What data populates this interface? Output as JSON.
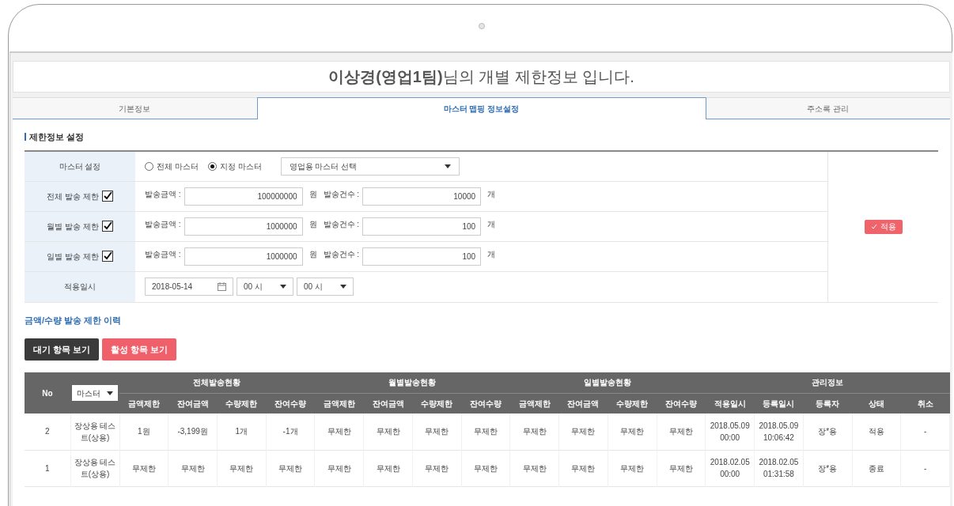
{
  "title": "**이상경(영업1팀)**님의 개별 제한정보 입니다.",
  "tabs": [
    {
      "label": "기본정보",
      "selected": false
    },
    {
      "label": "마스터 맵핑 정보설정",
      "selected": true
    },
    {
      "label": "주소록 관리",
      "selected": false
    }
  ],
  "section_title": "제한정보 설정",
  "form": {
    "master": {
      "label": "마스터 설정",
      "radios": [
        {
          "label": "전체 마스터",
          "selected": false
        },
        {
          "label": "지정 마스터",
          "selected": true
        }
      ],
      "select": "영업용 마스터 선택"
    },
    "limits": [
      {
        "label": "전체 발송 제한",
        "checked": true,
        "amount_label": "발송금액 :",
        "amount": "100000000",
        "amount_unit": "원",
        "count_label": "발송건수 :",
        "count": "10000",
        "count_unit": "개"
      },
      {
        "label": "월별 발송 제한",
        "checked": true,
        "amount_label": "발송금액 :",
        "amount": "1000000",
        "amount_unit": "원",
        "count_label": "발송건수 :",
        "count": "100",
        "count_unit": "개"
      },
      {
        "label": "일별 발송 제한",
        "checked": true,
        "amount_label": "발송금액 :",
        "amount": "1000000",
        "amount_unit": "원",
        "count_label": "발송건수 :",
        "count": "100",
        "count_unit": "개"
      }
    ],
    "apply_date": {
      "label": "적용일시",
      "date": "2018-05-14",
      "hour": "00 시",
      "minute": "00 시"
    },
    "apply_button": "적용"
  },
  "history_title": "금액/수량 발송 제한 이력",
  "view_buttons": [
    {
      "label": "대기 항목 보기",
      "kind": "dark"
    },
    {
      "label": "활성 항목 보기",
      "kind": "accent"
    }
  ],
  "table": {
    "header_rows": [
      [
        {
          "text": "No",
          "kind": "label",
          "rowspan": 2
        },
        {
          "text": "마스터",
          "kind": "filter",
          "rowspan": 2
        },
        {
          "text": "전체발송현황",
          "kind": "group",
          "colspan": 4
        },
        {
          "text": "월별발송현황",
          "kind": "group",
          "colspan": 4
        },
        {
          "text": "일별발송현황",
          "kind": "group",
          "colspan": 4
        },
        {
          "text": "관리정보",
          "kind": "group",
          "colspan": 5
        }
      ],
      [
        {
          "text": "금액제한",
          "kind": "label"
        },
        {
          "text": "잔여금액",
          "kind": "label"
        },
        {
          "text": "수량제한",
          "kind": "label"
        },
        {
          "text": "잔여수량",
          "kind": "label"
        },
        {
          "text": "금액제한",
          "kind": "label"
        },
        {
          "text": "잔여금액",
          "kind": "label"
        },
        {
          "text": "수량제한",
          "kind": "label"
        },
        {
          "text": "잔여수량",
          "kind": "label"
        },
        {
          "text": "금액제한",
          "kind": "label"
        },
        {
          "text": "잔여금액",
          "kind": "label"
        },
        {
          "text": "수량제한",
          "kind": "label"
        },
        {
          "text": "잔여수량",
          "kind": "label"
        },
        {
          "text": "적용일시",
          "kind": "label"
        },
        {
          "text": "등록일시",
          "kind": "label"
        },
        {
          "text": "등록자",
          "kind": "label"
        },
        {
          "text": "상태",
          "kind": "label"
        },
        {
          "text": "취소",
          "kind": "label"
        }
      ]
    ],
    "rows": [
      [
        "2",
        "장상용 테스트(상용)",
        "1원",
        "-3,199원",
        "1개",
        "-1개",
        "무제한",
        "무제한",
        "무제한",
        "무제한",
        "무제한",
        "무제한",
        "무제한",
        "무제한",
        "2018.05.09 00:00",
        "2018.05.09 10:06:42",
        "장*용",
        "적용",
        "-"
      ],
      [
        "1",
        "장상용 테스트(상용)",
        "무제한",
        "무제한",
        "무제한",
        "무제한",
        "무제한",
        "무제한",
        "무제한",
        "무제한",
        "무제한",
        "무제한",
        "무제한",
        "무제한",
        "2018.02.05 00:00",
        "2018.02.05 01:31:58",
        "장*용",
        "종료",
        "-"
      ]
    ]
  }
}
